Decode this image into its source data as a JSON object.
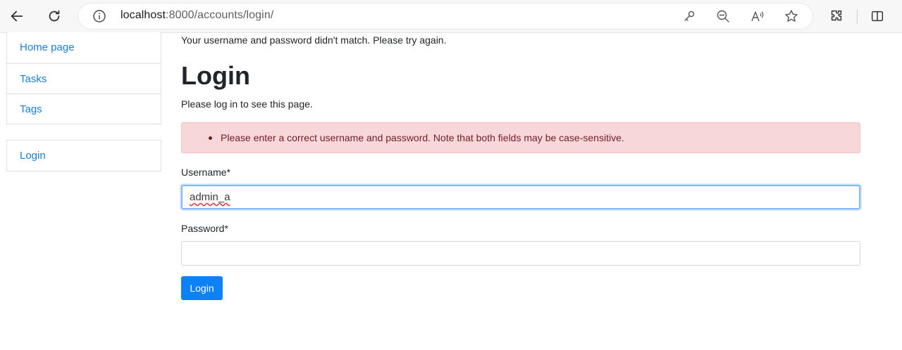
{
  "browser": {
    "url_host": "localhost",
    "url_rest": ":8000/accounts/login/"
  },
  "sidebar": {
    "items": [
      {
        "label": "Home page"
      },
      {
        "label": "Tasks"
      },
      {
        "label": "Tags"
      }
    ],
    "account_items": [
      {
        "label": "Login"
      }
    ]
  },
  "main": {
    "error_message": "Your username and password didn't match. Please try again.",
    "title": "Login",
    "subtitle": "Please log in to see this page.",
    "alert_text": "Please enter a correct username and password. Note that both fields may be case-sensitive.",
    "username_label": "Username*",
    "username_value": "admin_a",
    "password_label": "Password*",
    "password_value": "",
    "submit_label": "Login"
  },
  "colors": {
    "link": "#1a7fd0",
    "alert_bg": "#f8d7da",
    "alert_text": "#721c24",
    "button": "#0d82f7"
  }
}
